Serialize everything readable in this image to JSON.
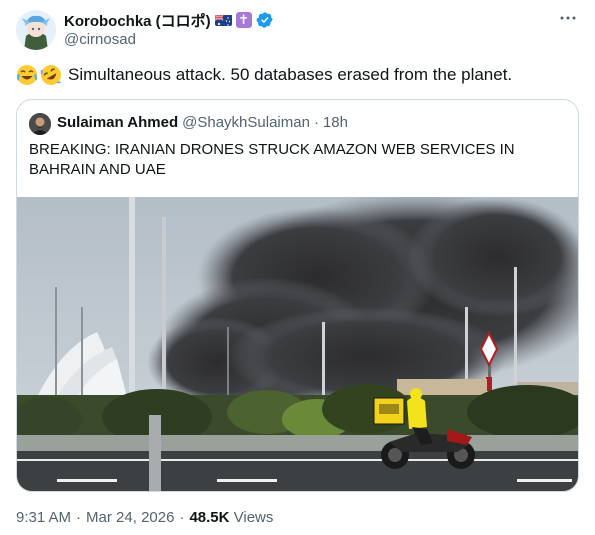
{
  "author": {
    "display_name": "Korobochka (コロポ)",
    "handle": "@cirnosad"
  },
  "tweet": {
    "text": "Simultaneous attack. 50 databases erased from the planet."
  },
  "quote": {
    "display_name": "Sulaiman Ahmed",
    "handle": "@ShaykhSulaiman",
    "separator": "·",
    "time": "18h",
    "text": "BREAKING: IRANIAN DRONES STRUCK AMAZON WEB SERVICES IN BAHRAIN AND UAE"
  },
  "footer": {
    "time": "9:31 AM",
    "separator": "·",
    "date": "Mar 24, 2026",
    "separator2": "·",
    "views_count": "48.5K",
    "views_label": "Views"
  },
  "icons": {
    "verified": "verified-badge-icon",
    "more": "more-horizontal-icon"
  },
  "colors": {
    "verified": "#1d9bf0",
    "muted_text": "#536471"
  }
}
